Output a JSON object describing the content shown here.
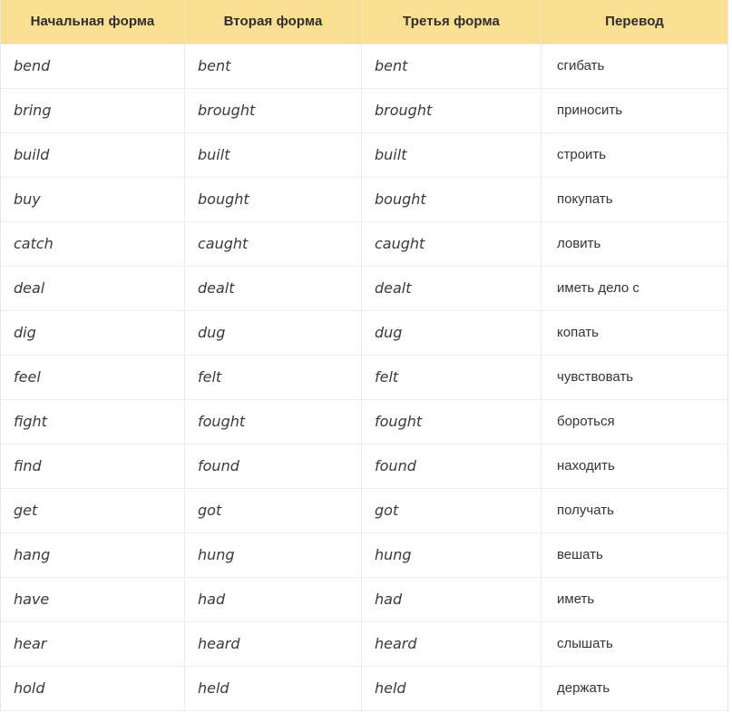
{
  "table": {
    "headers": [
      "Начальная форма",
      "Вторая форма",
      "Третья форма",
      "Перевод"
    ],
    "rows": [
      {
        "base": "bend",
        "past": "bent",
        "participle": "bent",
        "translation": "сгибать"
      },
      {
        "base": "bring",
        "past": "brought",
        "participle": "brought",
        "translation": "приносить"
      },
      {
        "base": "build",
        "past": "built",
        "participle": "built",
        "translation": "строить"
      },
      {
        "base": "buy",
        "past": "bought",
        "participle": "bought",
        "translation": "покупать"
      },
      {
        "base": "catch",
        "past": "caught",
        "participle": "caught",
        "translation": "ловить"
      },
      {
        "base": "deal",
        "past": "dealt",
        "participle": "dealt",
        "translation": "иметь дело с"
      },
      {
        "base": "dig",
        "past": "dug",
        "participle": "dug",
        "translation": "копать"
      },
      {
        "base": "feel",
        "past": "felt",
        "participle": "felt",
        "translation": "чувствовать"
      },
      {
        "base": "fight",
        "past": "fought",
        "participle": "fought",
        "translation": "бороться"
      },
      {
        "base": "find",
        "past": "found",
        "participle": "found",
        "translation": "находить"
      },
      {
        "base": "get",
        "past": "got",
        "participle": "got",
        "translation": "получать"
      },
      {
        "base": "hang",
        "past": "hung",
        "participle": "hung",
        "translation": "вешать"
      },
      {
        "base": "have",
        "past": "had",
        "participle": "had",
        "translation": "иметь"
      },
      {
        "base": "hear",
        "past": "heard",
        "participle": "heard",
        "translation": "слышать"
      },
      {
        "base": "hold",
        "past": "held",
        "participle": "held",
        "translation": "держать"
      }
    ]
  },
  "colors": {
    "header_background": "#f8df92",
    "header_text": "#2e2e2e",
    "row_border": "#ededed",
    "cell_text": "#3b3b3b",
    "page_background": "#ffffff"
  }
}
